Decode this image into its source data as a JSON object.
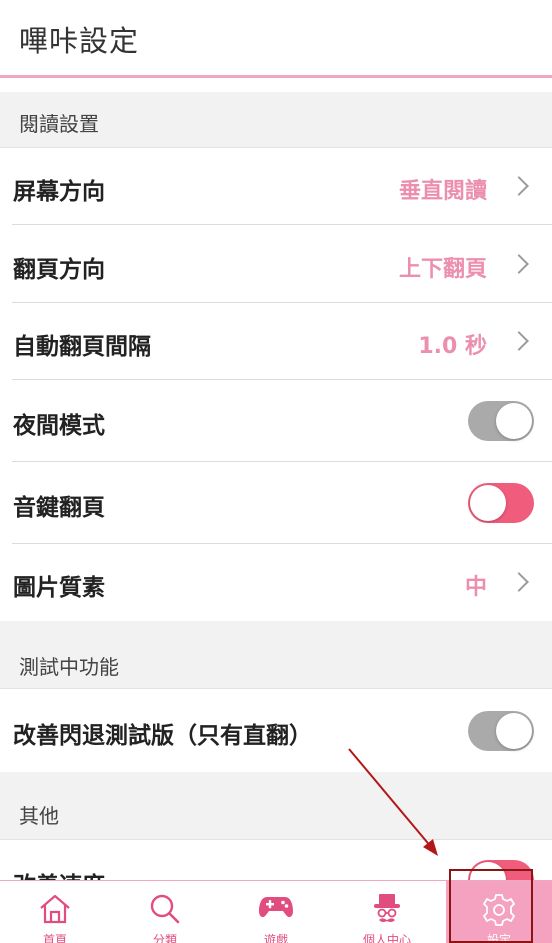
{
  "header": {
    "title": "嗶咔設定"
  },
  "sections": {
    "reading": "閱讀設置",
    "testing": "測試中功能",
    "other": "其他"
  },
  "rows": {
    "screen_orientation": {
      "label": "屏幕方向",
      "value": "垂直閱讀"
    },
    "page_direction": {
      "label": "翻頁方向",
      "value": "上下翻頁"
    },
    "auto_interval": {
      "label": "自動翻頁間隔",
      "value": "1.0 秒"
    },
    "night_mode": {
      "label": "夜間模式",
      "toggle": "off"
    },
    "volume_key": {
      "label": "音鍵翻頁",
      "toggle": "on"
    },
    "image_quality": {
      "label": "圖片質素",
      "value": "中"
    },
    "crash_beta": {
      "label": "改善閃退測試版（只有直翻）",
      "toggle": "off"
    },
    "improve_speed": {
      "label": "改善速度",
      "toggle": "on"
    }
  },
  "navbar": {
    "items": [
      {
        "label": "首頁",
        "icon": "home-icon"
      },
      {
        "label": "分類",
        "icon": "search-icon"
      },
      {
        "label": "遊戲",
        "icon": "gamepad-icon"
      },
      {
        "label": "個人中心",
        "icon": "gentleman-avatar-icon"
      },
      {
        "label": "設定",
        "icon": "gear-icon",
        "active": true
      }
    ]
  },
  "colors": {
    "accent_pink": "#ec8fae",
    "toggle_on": "#f05c7c",
    "toggle_off": "#aaaaaa",
    "nav_active_bg": "#f4a2bf"
  }
}
